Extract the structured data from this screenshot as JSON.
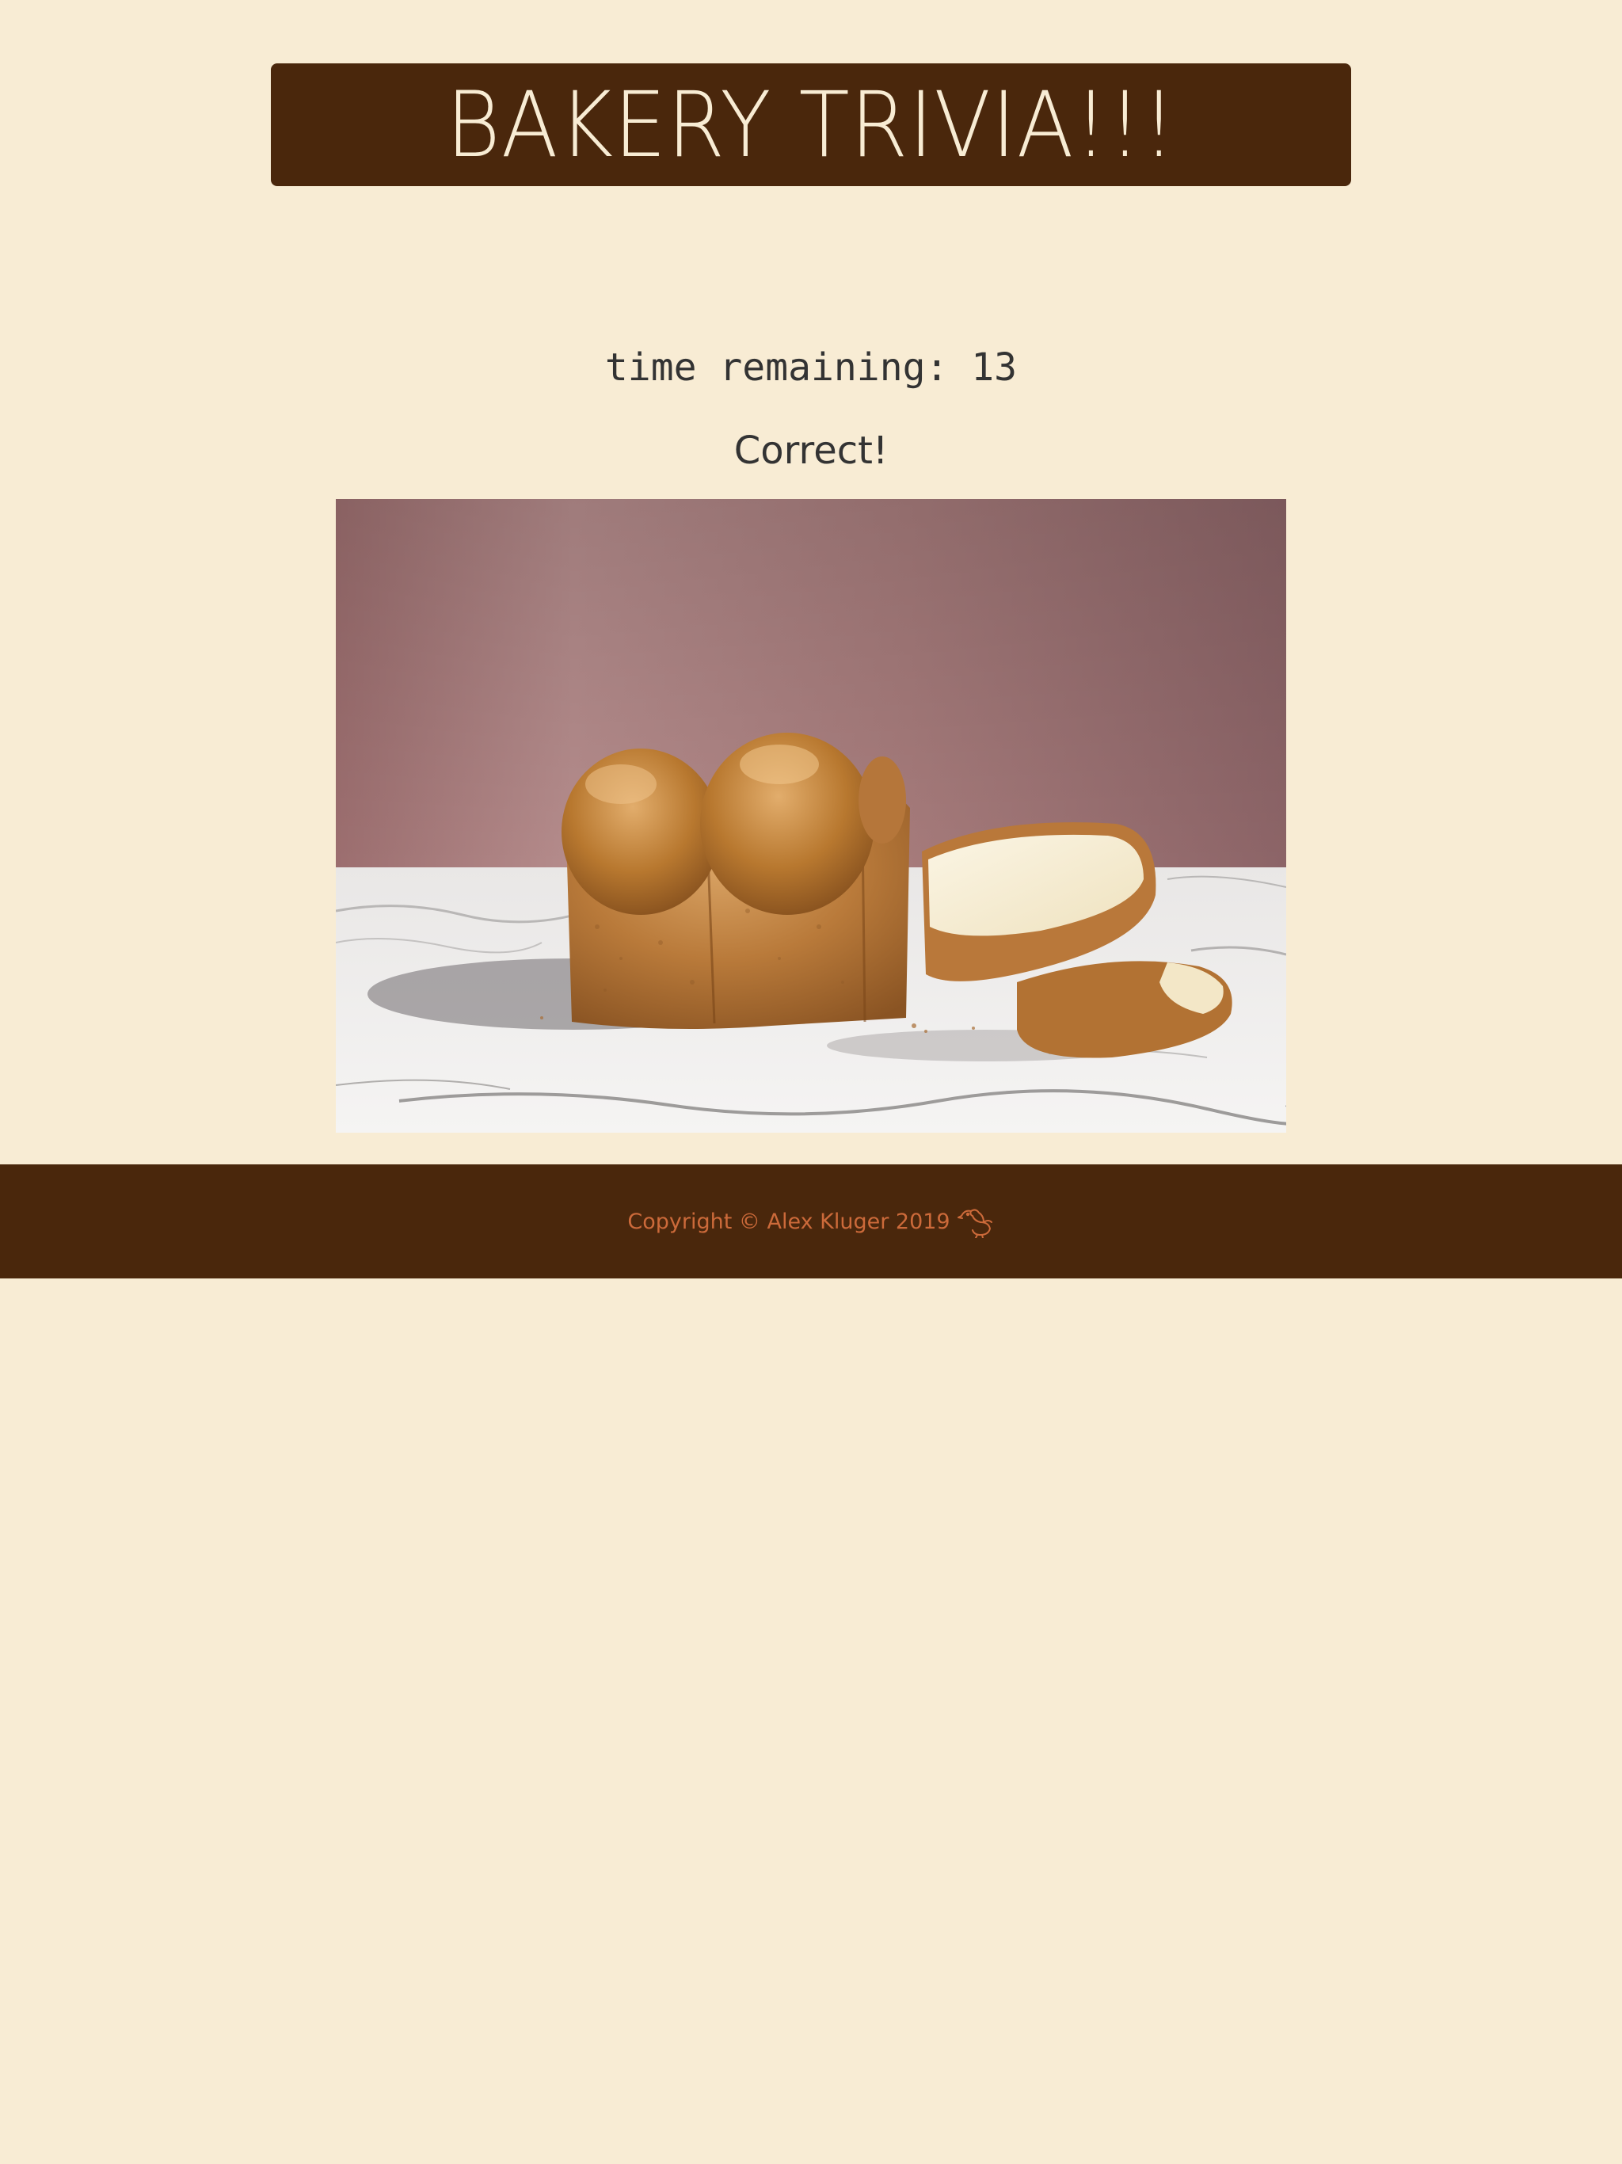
{
  "header": {
    "title": "BAKERY TRIVIA!!!"
  },
  "quiz": {
    "timer_text": "time remaining: 13",
    "result_text": "Correct!",
    "image_icon": "bread-loaf-photo"
  },
  "footer": {
    "copyright": "Copyright © Alex Kluger 2019",
    "icon": "rooster-icon"
  },
  "colors": {
    "background": "#f8ecd4",
    "banner": "#4a270c",
    "banner_text": "#f8ecd4",
    "body_text": "#333333",
    "footer_text": "#cc6a3a"
  }
}
